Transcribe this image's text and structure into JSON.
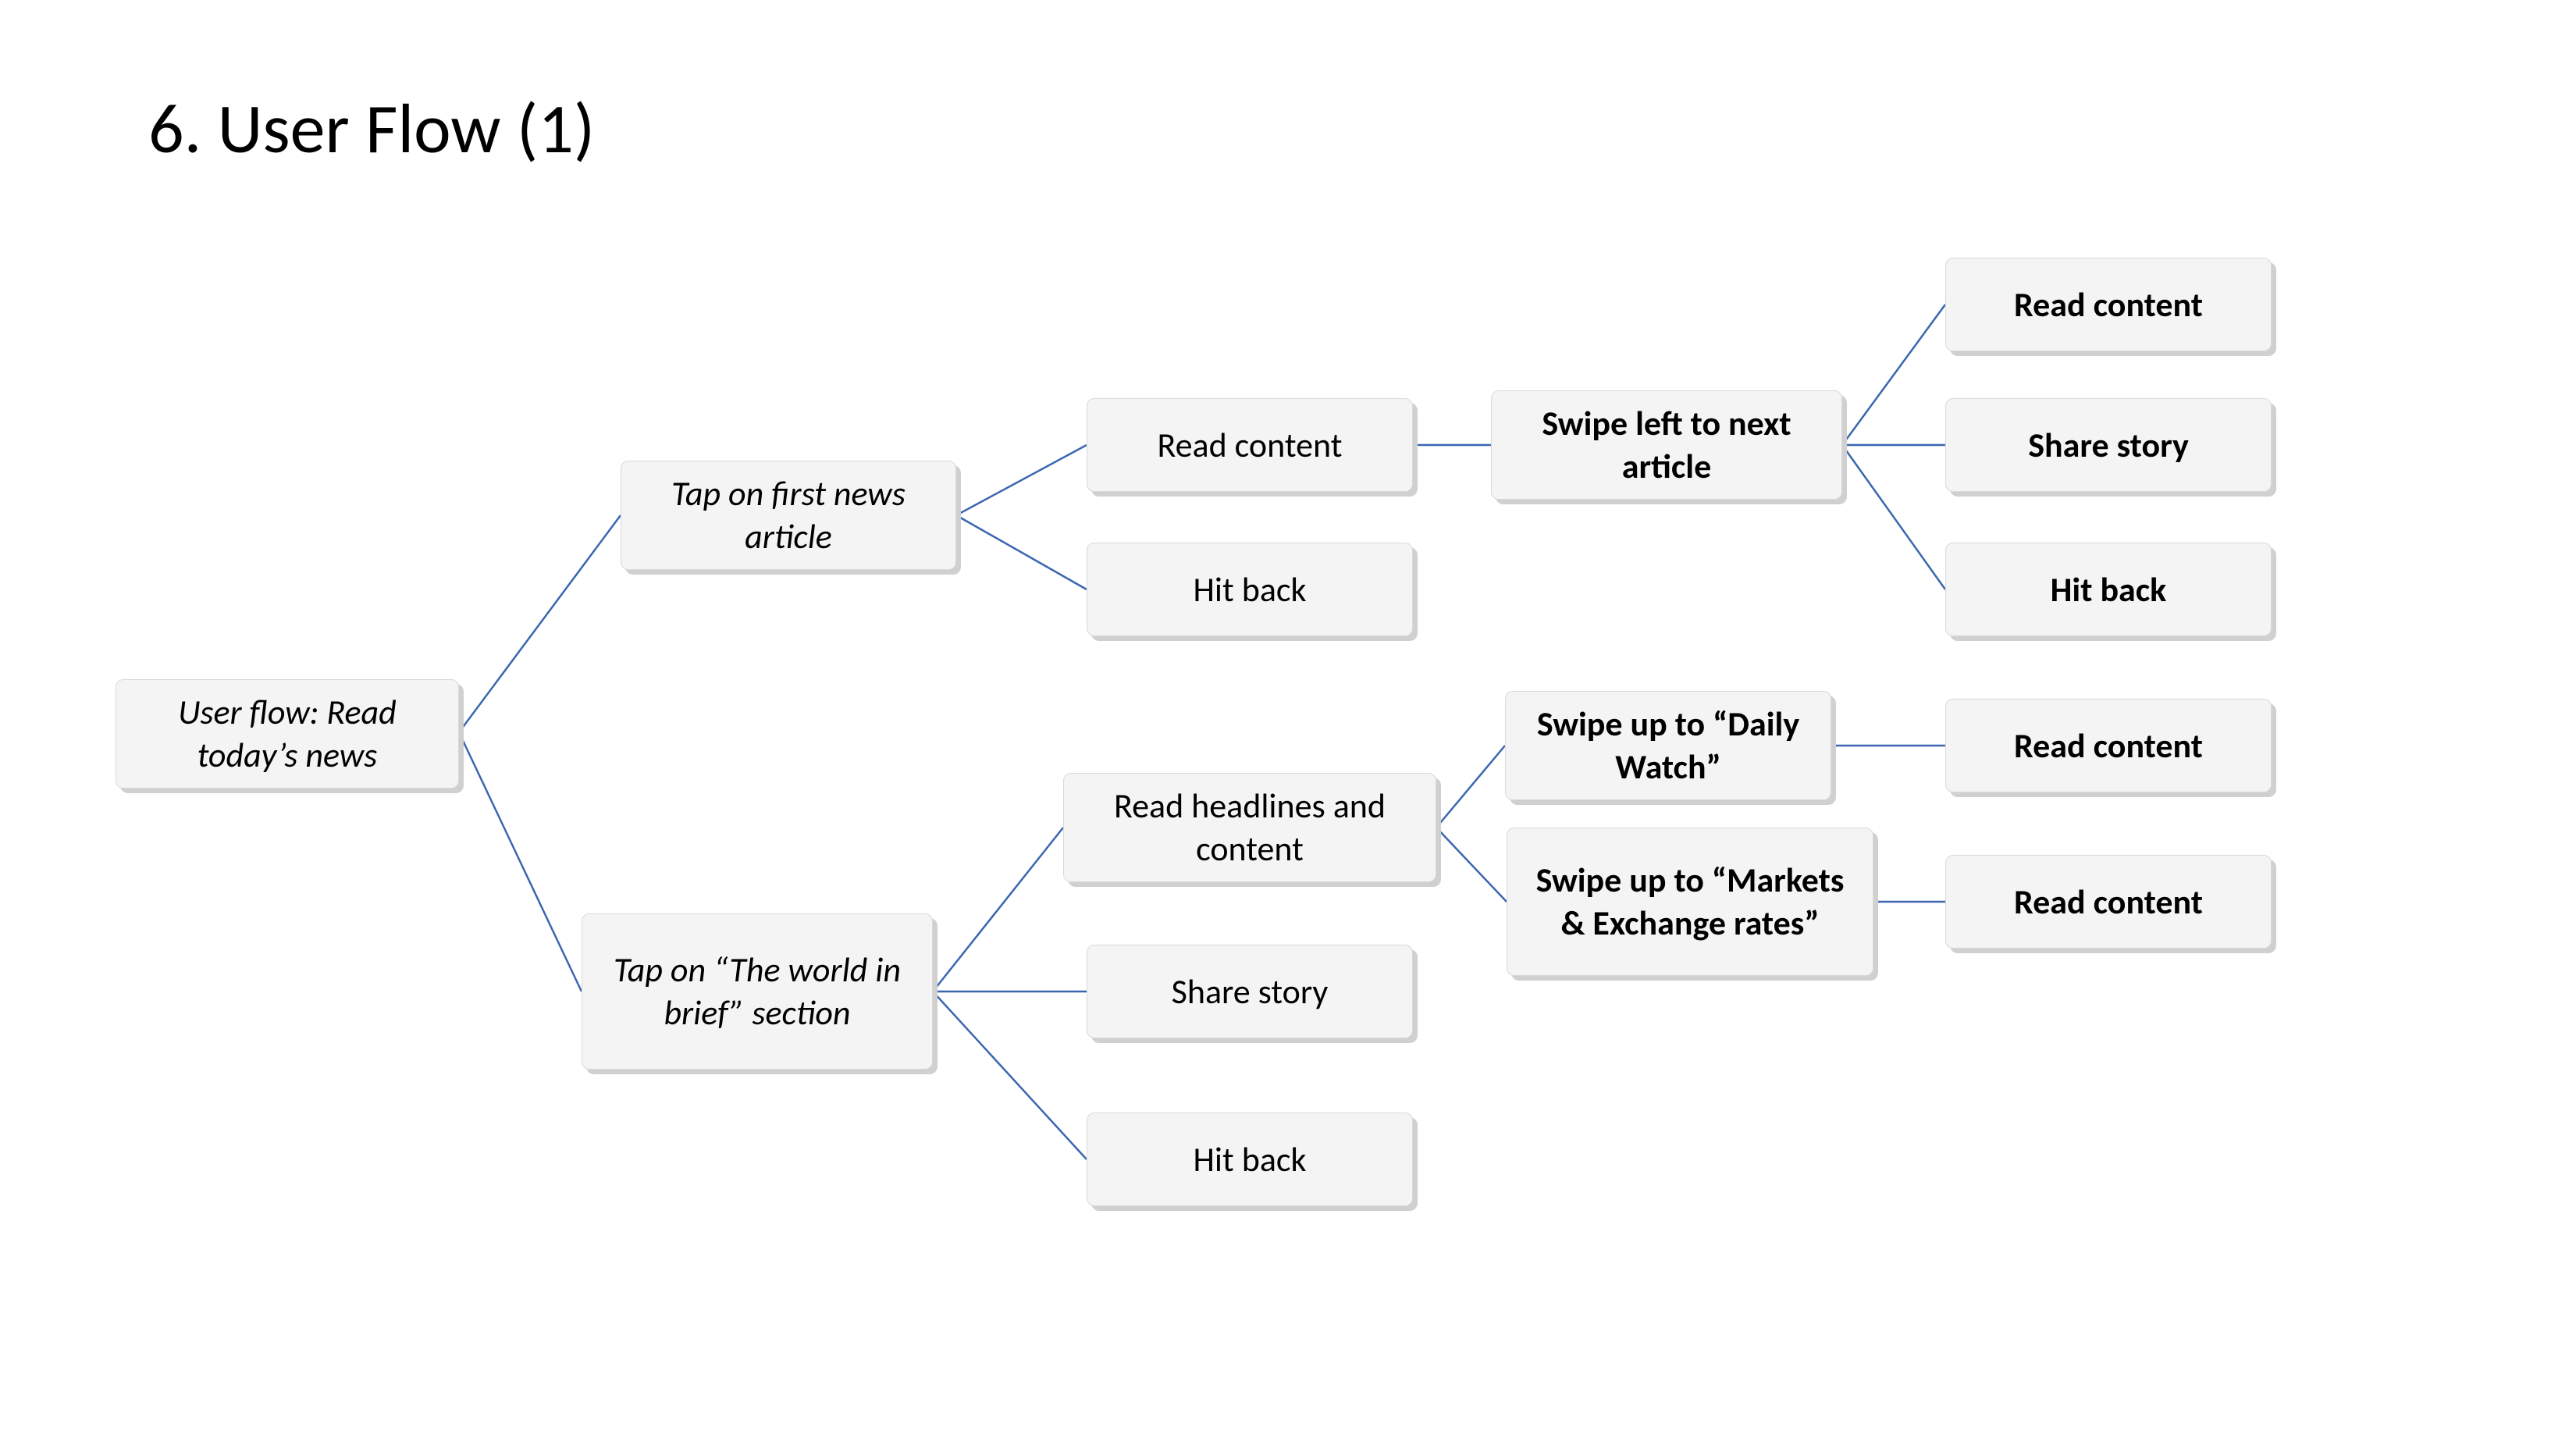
{
  "title": "6. User Flow (1)",
  "colors": {
    "nodeFill": "#f4f4f4",
    "nodeBorder": "#d9d9d9",
    "nodeShadow": "#d0d0d0",
    "connector": "#3b66b0"
  },
  "nodes": {
    "root": {
      "label": "User flow: Read today’s news"
    },
    "tapFirst": {
      "label": "Tap on first news article"
    },
    "tapWorld": {
      "label": "Tap on “The world in brief” section"
    },
    "readContent1": {
      "label": "Read content"
    },
    "hitBack1": {
      "label": "Hit back"
    },
    "readHeadlines": {
      "label": "Read headlines and content"
    },
    "shareStory2": {
      "label": "Share story"
    },
    "hitBack2": {
      "label": "Hit back"
    },
    "swipeLeft": {
      "label": "Swipe left to next article"
    },
    "swipeDaily": {
      "label": "Swipe up to “Daily Watch”"
    },
    "swipeMarkets": {
      "label": "Swipe up to “Markets & Exchange rates”"
    },
    "readContent3": {
      "label": "Read content"
    },
    "shareStory3": {
      "label": "Share story"
    },
    "hitBack3": {
      "label": "Hit back"
    },
    "readContent4": {
      "label": "Read content"
    },
    "readContent5": {
      "label": "Read content"
    }
  },
  "edges": [
    [
      "root",
      "tapFirst"
    ],
    [
      "root",
      "tapWorld"
    ],
    [
      "tapFirst",
      "readContent1"
    ],
    [
      "tapFirst",
      "hitBack1"
    ],
    [
      "readContent1",
      "swipeLeft"
    ],
    [
      "swipeLeft",
      "readContent3"
    ],
    [
      "swipeLeft",
      "shareStory3"
    ],
    [
      "swipeLeft",
      "hitBack3"
    ],
    [
      "tapWorld",
      "readHeadlines"
    ],
    [
      "tapWorld",
      "shareStory2"
    ],
    [
      "tapWorld",
      "hitBack2"
    ],
    [
      "readHeadlines",
      "swipeDaily"
    ],
    [
      "readHeadlines",
      "swipeMarkets"
    ],
    [
      "swipeDaily",
      "readContent4"
    ],
    [
      "swipeMarkets",
      "readContent5"
    ]
  ]
}
